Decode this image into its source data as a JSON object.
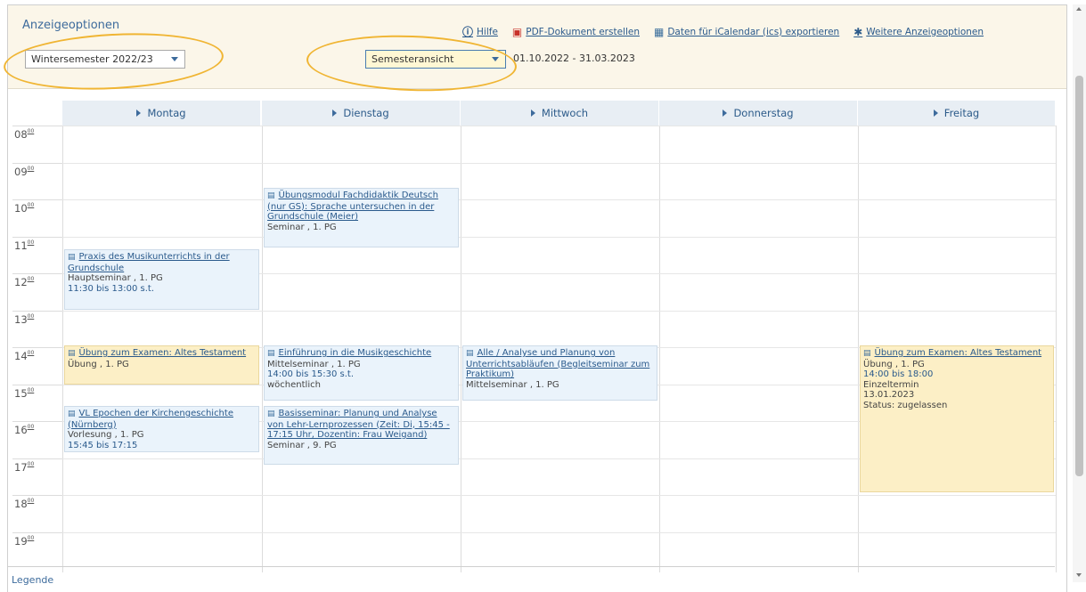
{
  "header": {
    "title": "Anzeigeoptionen",
    "links": [
      {
        "icon": "info-icon",
        "glyph": "ⓘ",
        "label": "Hilfe"
      },
      {
        "icon": "pdf-icon",
        "glyph": "▣",
        "label": "PDF-Dokument erstellen"
      },
      {
        "icon": "calendar-export-icon",
        "glyph": "▦",
        "label": "Daten für iCalendar (ics) exportieren"
      },
      {
        "icon": "gear-icon",
        "glyph": "✱",
        "label": "Weitere Anzeigeoptionen"
      }
    ],
    "semester_select": "Wintersemester 2022/23",
    "view_select": "Semesteransicht",
    "date_range": "01.10.2022 - 31.03.2023"
  },
  "days": [
    "Montag",
    "Dienstag",
    "Mittwoch",
    "Donnerstag",
    "Freitag"
  ],
  "times": [
    "08",
    "09",
    "10",
    "11",
    "12",
    "13",
    "14",
    "15",
    "16",
    "17",
    "18",
    "19"
  ],
  "time_suffix": "00",
  "events": [
    {
      "day": 1,
      "color": "blue",
      "title": "Übungsmodul Fachdidaktik Deutsch (nur GS): Sprache untersuchen in der Grundschule (Meier)",
      "lines": [
        {
          "text": "Seminar , 1. PG"
        }
      ]
    },
    {
      "day": 0,
      "color": "blue",
      "title": "Praxis des Musikunterrichts in der Grundschule",
      "lines": [
        {
          "text": "Hauptseminar , 1. PG"
        },
        {
          "text": "11:30 bis 13:00 s.t.",
          "cls": "tm"
        }
      ]
    },
    {
      "day": 0,
      "color": "yellow",
      "title": "Übung zum Examen: Altes Testament",
      "lines": [
        {
          "text": "Übung , 1. PG"
        }
      ]
    },
    {
      "day": 1,
      "color": "blue",
      "title": "Einführung in die Musikgeschichte",
      "lines": [
        {
          "text": "Mittelseminar , 1. PG"
        },
        {
          "text": "14:00 bis 15:30 s.t.",
          "cls": "tm"
        },
        {
          "text": "wöchentlich"
        }
      ]
    },
    {
      "day": 2,
      "color": "blue",
      "title": "Alle / Analyse und Planung von Unterrichtsabläufen (Begleitseminar zum Praktikum)",
      "lines": [
        {
          "text": "Mittelseminar , 1. PG"
        }
      ]
    },
    {
      "day": 4,
      "color": "yellow",
      "title": "Übung zum Examen: Altes Testament",
      "lines": [
        {
          "text": "Übung , 1. PG"
        },
        {
          "text": "14:00 bis 18:00",
          "cls": "tm"
        },
        {
          "text": "Einzeltermin"
        },
        {
          "text": "13.01.2023"
        },
        {
          "text": "Status: zugelassen"
        }
      ]
    },
    {
      "day": 0,
      "color": "blue",
      "title": "VL Epochen der Kirchengeschichte (Nürnberg)",
      "lines": [
        {
          "text": "Vorlesung , 1. PG"
        },
        {
          "text": "15:45 bis 17:15",
          "cls": "tm"
        }
      ]
    },
    {
      "day": 1,
      "color": "blue",
      "title": "Basisseminar: Planung und Analyse von Lehr-Lernprozessen (Zeit: Di, 15:45 - 17:15 Uhr, Dozentin: Frau Weigand)",
      "lines": [
        {
          "text": "Seminar , 9. PG"
        }
      ]
    }
  ],
  "legend": "Legende"
}
